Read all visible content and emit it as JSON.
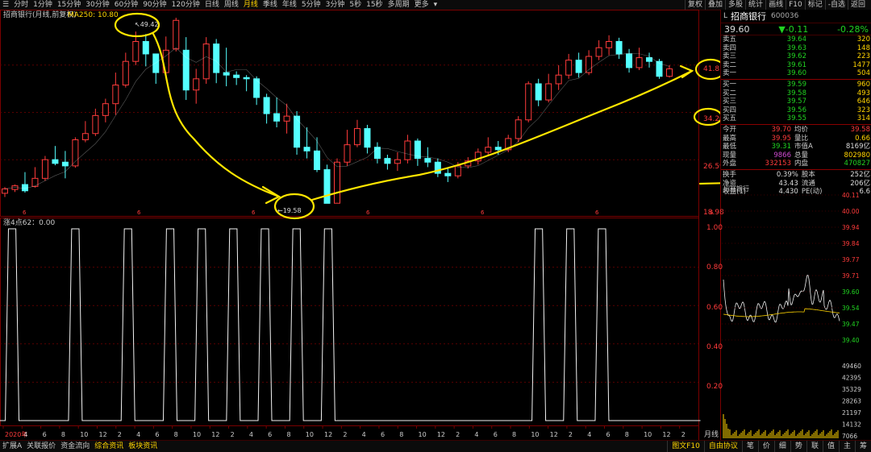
{
  "toolbar": {
    "periods": [
      "分时",
      "1分钟",
      "15分钟",
      "30分钟",
      "60分钟",
      "90分钟",
      "120分钟",
      "日线",
      "周线",
      "月线",
      "季线",
      "年线",
      "5分钟",
      "3分钟",
      "5秒",
      "15秒",
      "多周期",
      "更多"
    ],
    "selected_period": "月线",
    "right": [
      "复权",
      "叠加",
      "多股",
      "统计",
      "画线",
      "F10",
      "标记",
      "-自选",
      "返回"
    ]
  },
  "chart": {
    "title": "招商银行(月线,前复权)",
    "ma_label": "MA250: 10.80",
    "price_axis": [
      "41.81",
      "34.20",
      "26.59",
      "18.98"
    ],
    "annot_high": "49.42",
    "annot_low": "19.58",
    "indicator_title": "涨4点62：0.00",
    "indicator_axis": [
      "1.00",
      "0.80",
      "0.60",
      "0.40",
      "0.20"
    ],
    "x_labels": [
      "2020年",
      "4",
      "6",
      "8",
      "10",
      "12",
      "2",
      "4",
      "6",
      "8",
      "10",
      "12",
      "2",
      "4",
      "6",
      "8",
      "10",
      "12",
      "2",
      "4",
      "6",
      "8",
      "10",
      "12",
      "2",
      "4",
      "6",
      "8",
      "10",
      "12",
      "2",
      "4",
      "6",
      "8",
      "10",
      "12",
      "2"
    ],
    "top_x_marks": [
      "6",
      "6",
      "6",
      "6",
      "6",
      "6",
      "6"
    ],
    "period_tag": "月线"
  },
  "quote": {
    "flag": "L",
    "name": "招商银行",
    "code": "600036",
    "price": "39.60",
    "change": "▼-0.11",
    "pct": "-0.28%",
    "asks": [
      {
        "label": "卖五",
        "price": "39.64",
        "vol": "320"
      },
      {
        "label": "卖四",
        "price": "39.63",
        "vol": "148"
      },
      {
        "label": "卖三",
        "price": "39.62",
        "vol": "223"
      },
      {
        "label": "卖二",
        "price": "39.61",
        "vol": "1477"
      },
      {
        "label": "卖一",
        "price": "39.60",
        "vol": "504"
      }
    ],
    "bids": [
      {
        "label": "买一",
        "price": "39.59",
        "vol": "960"
      },
      {
        "label": "买二",
        "price": "39.58",
        "vol": "493"
      },
      {
        "label": "买三",
        "price": "39.57",
        "vol": "646"
      },
      {
        "label": "买四",
        "price": "39.56",
        "vol": "323"
      },
      {
        "label": "买五",
        "price": "39.55",
        "vol": "314"
      }
    ],
    "stats": [
      [
        "今开",
        "39.70",
        "均价",
        "39.58"
      ],
      [
        "最高",
        "39.95",
        "量比",
        "0.66"
      ],
      [
        "最低",
        "39.31",
        "市值A",
        "8169亿"
      ],
      [
        "现量",
        "9866",
        "总量",
        "802980"
      ],
      [
        "外盘",
        "332153",
        "内盘",
        "470827"
      ]
    ],
    "stats2": [
      [
        "换手",
        "0.39%",
        "股本",
        "252亿"
      ],
      [
        "净资",
        "43.43",
        "流通",
        "206亿"
      ],
      [
        "收益(1)",
        "4.430",
        "PE(动)",
        "6.6"
      ]
    ]
  },
  "intraday": {
    "title": "招商银行",
    "price_axis": [
      "40.11",
      "40.00",
      "39.94",
      "39.84",
      "39.77",
      "39.71",
      "39.60",
      "39.54",
      "39.47",
      "39.40"
    ],
    "vol_axis": [
      "49460",
      "42395",
      "35329",
      "28263",
      "21197",
      "14132",
      "7066"
    ]
  },
  "bottom": {
    "left": [
      "扩展A",
      "关联报价",
      "资金流向",
      "综合资讯",
      "板块资讯"
    ],
    "mid": [
      "图文F10",
      "自由协议"
    ],
    "right": [
      "笔",
      "价",
      "细",
      "势",
      "联",
      "值",
      "主",
      "筹"
    ]
  },
  "chart_data": {
    "type": "candlestick",
    "monthly": [
      {
        "o": 21.2,
        "c": 21.9,
        "h": 22.2,
        "l": 20.6
      },
      {
        "o": 21.8,
        "c": 22.4,
        "h": 22.6,
        "l": 21.4
      },
      {
        "o": 22.6,
        "c": 21.6,
        "h": 24.6,
        "l": 21.3
      },
      {
        "o": 22.3,
        "c": 23.6,
        "h": 25.4,
        "l": 22.1
      },
      {
        "o": 23.6,
        "c": 26.6,
        "h": 27.2,
        "l": 23.2
      },
      {
        "o": 26.6,
        "c": 26.0,
        "h": 28.8,
        "l": 25.7
      },
      {
        "o": 26.2,
        "c": 25.6,
        "h": 28.0,
        "l": 23.6
      },
      {
        "o": 25.6,
        "c": 29.8,
        "h": 30.2,
        "l": 25.3
      },
      {
        "o": 29.8,
        "c": 30.8,
        "h": 32.8,
        "l": 29.4
      },
      {
        "o": 30.8,
        "c": 33.7,
        "h": 34.8,
        "l": 30.4
      },
      {
        "o": 33.7,
        "c": 35.6,
        "h": 36.4,
        "l": 32.6
      },
      {
        "o": 35.6,
        "c": 38.6,
        "h": 40.6,
        "l": 33.8
      },
      {
        "o": 38.6,
        "c": 42.4,
        "h": 43.8,
        "l": 38.2
      },
      {
        "o": 42.4,
        "c": 45.6,
        "h": 47.2,
        "l": 41.8
      },
      {
        "o": 45.6,
        "c": 43.6,
        "h": 46.8,
        "l": 41.6
      },
      {
        "o": 43.6,
        "c": 40.6,
        "h": 43.2,
        "l": 38.8
      },
      {
        "o": 40.6,
        "c": 44.2,
        "h": 46.4,
        "l": 40.2
      },
      {
        "o": 44.4,
        "c": 49.0,
        "h": 49.42,
        "l": 44.0
      },
      {
        "o": 44.2,
        "c": 37.8,
        "h": 46.3,
        "l": 36.2
      },
      {
        "o": 37.8,
        "c": 39.6,
        "h": 41.2,
        "l": 35.6
      },
      {
        "o": 39.6,
        "c": 45.2,
        "h": 46.3,
        "l": 38.8
      },
      {
        "o": 45.2,
        "c": 40.6,
        "h": 46.0,
        "l": 38.9
      },
      {
        "o": 40.6,
        "c": 40.2,
        "h": 44.6,
        "l": 38.4
      },
      {
        "o": 40.2,
        "c": 39.8,
        "h": 40.8,
        "l": 38.6
      },
      {
        "o": 39.8,
        "c": 39.6,
        "h": 40.2,
        "l": 37.6
      },
      {
        "o": 39.6,
        "c": 36.6,
        "h": 40.0,
        "l": 35.4
      },
      {
        "o": 36.6,
        "c": 34.0,
        "h": 37.2,
        "l": 32.4
      },
      {
        "o": 34.0,
        "c": 32.8,
        "h": 36.6,
        "l": 31.8
      },
      {
        "o": 32.8,
        "c": 33.6,
        "h": 35.6,
        "l": 30.8
      },
      {
        "o": 33.6,
        "c": 28.6,
        "h": 34.4,
        "l": 27.4
      },
      {
        "o": 28.6,
        "c": 28.0,
        "h": 31.8,
        "l": 26.8
      },
      {
        "o": 28.0,
        "c": 25.0,
        "h": 30.2,
        "l": 24.6
      },
      {
        "o": 25.0,
        "c": 19.58,
        "h": 25.8,
        "l": 19.58
      },
      {
        "o": 19.6,
        "c": 26.2,
        "h": 26.8,
        "l": 19.58
      },
      {
        "o": 26.2,
        "c": 29.0,
        "h": 31.4,
        "l": 25.6
      },
      {
        "o": 29.0,
        "c": 31.6,
        "h": 33.0,
        "l": 28.6
      },
      {
        "o": 31.6,
        "c": 28.6,
        "h": 32.2,
        "l": 27.6
      },
      {
        "o": 28.6,
        "c": 26.8,
        "h": 29.4,
        "l": 26.0
      },
      {
        "o": 26.8,
        "c": 26.0,
        "h": 27.4,
        "l": 25.0
      },
      {
        "o": 26.0,
        "c": 26.6,
        "h": 27.8,
        "l": 24.8
      },
      {
        "o": 26.6,
        "c": 29.6,
        "h": 30.6,
        "l": 26.0
      },
      {
        "o": 29.6,
        "c": 26.8,
        "h": 30.0,
        "l": 25.6
      },
      {
        "o": 26.8,
        "c": 26.2,
        "h": 28.6,
        "l": 25.4
      },
      {
        "o": 26.2,
        "c": 24.4,
        "h": 26.8,
        "l": 23.8
      },
      {
        "o": 24.4,
        "c": 24.0,
        "h": 25.2,
        "l": 23.0
      },
      {
        "o": 24.0,
        "c": 25.6,
        "h": 26.2,
        "l": 23.6
      },
      {
        "o": 25.6,
        "c": 26.4,
        "h": 27.0,
        "l": 25.2
      },
      {
        "o": 26.4,
        "c": 27.8,
        "h": 28.4,
        "l": 25.8
      },
      {
        "o": 27.8,
        "c": 28.6,
        "h": 30.2,
        "l": 27.4
      },
      {
        "o": 28.6,
        "c": 28.2,
        "h": 29.6,
        "l": 27.4
      },
      {
        "o": 28.2,
        "c": 30.0,
        "h": 30.6,
        "l": 27.8
      },
      {
        "o": 30.0,
        "c": 33.0,
        "h": 33.6,
        "l": 29.4
      },
      {
        "o": 33.0,
        "c": 38.8,
        "h": 39.2,
        "l": 32.6
      },
      {
        "o": 38.8,
        "c": 36.2,
        "h": 39.6,
        "l": 35.2
      },
      {
        "o": 36.2,
        "c": 38.8,
        "h": 40.4,
        "l": 35.8
      },
      {
        "o": 38.8,
        "c": 40.2,
        "h": 41.8,
        "l": 37.8
      },
      {
        "o": 40.2,
        "c": 42.6,
        "h": 43.6,
        "l": 39.6
      },
      {
        "o": 42.6,
        "c": 40.6,
        "h": 43.8,
        "l": 39.8
      },
      {
        "o": 40.6,
        "c": 43.2,
        "h": 44.2,
        "l": 40.2
      },
      {
        "o": 43.2,
        "c": 44.6,
        "h": 45.8,
        "l": 42.6
      },
      {
        "o": 44.6,
        "c": 45.6,
        "h": 46.6,
        "l": 43.4
      },
      {
        "o": 45.6,
        "c": 43.6,
        "h": 46.2,
        "l": 42.8
      },
      {
        "o": 43.6,
        "c": 41.4,
        "h": 44.4,
        "l": 40.6
      },
      {
        "o": 41.4,
        "c": 43.0,
        "h": 44.6,
        "l": 41.0
      },
      {
        "o": 43.0,
        "c": 42.4,
        "h": 43.8,
        "l": 41.4
      },
      {
        "o": 42.4,
        "c": 40.0,
        "h": 42.8,
        "l": 39.6
      },
      {
        "o": 40.0,
        "c": 41.2,
        "h": 41.8,
        "l": 39.8
      }
    ],
    "ylim": [
      18.98,
      49.42
    ],
    "indicator_values": [
      0,
      1,
      0,
      0,
      0,
      0,
      0,
      1,
      0,
      0,
      0,
      0,
      1,
      0,
      0,
      0,
      1,
      0,
      0,
      1,
      0,
      0,
      1,
      0,
      0,
      1,
      0,
      0,
      1,
      0,
      0,
      1,
      0,
      0,
      0,
      0,
      0,
      0,
      0,
      0,
      0,
      0,
      0,
      0,
      0,
      0,
      0,
      0,
      0,
      0,
      0,
      1,
      0,
      0,
      1,
      0,
      0,
      1,
      0,
      0,
      0,
      0,
      0,
      0,
      0,
      0,
      0
    ]
  }
}
